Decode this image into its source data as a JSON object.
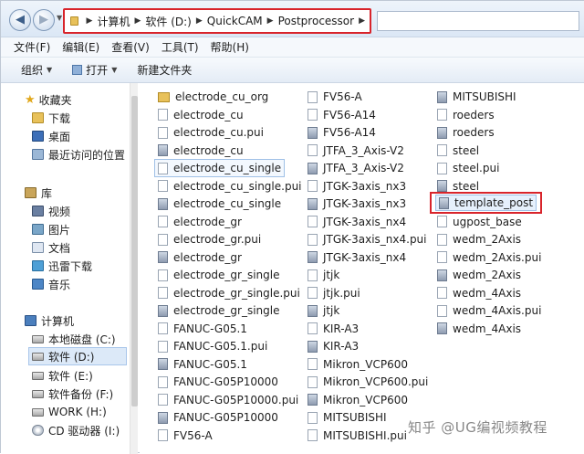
{
  "address": {
    "crumbs": [
      "计算机",
      "软件 (D:)",
      "QuickCAM",
      "Postprocessor"
    ],
    "back_glyph": "◀",
    "forward_glyph": "▶"
  },
  "menu": [
    "文件(F)",
    "编辑(E)",
    "查看(V)",
    "工具(T)",
    "帮助(H)"
  ],
  "toolbar": {
    "organize": "组织",
    "open": "打开",
    "new_folder": "新建文件夹"
  },
  "nav": {
    "favorites": {
      "label": "收藏夹",
      "items": [
        "下载",
        "桌面",
        "最近访问的位置"
      ]
    },
    "libraries": {
      "label": "库",
      "items": [
        "视频",
        "图片",
        "文档",
        "迅雷下载",
        "音乐"
      ]
    },
    "computer": {
      "label": "计算机",
      "items": [
        "本地磁盘 (C:)",
        "软件 (D:)",
        "软件 (E:)",
        "软件备份 (F:)",
        "WORK (H:)",
        "CD 驱动器 (I:)"
      ],
      "selected": "软件 (D:)"
    }
  },
  "files": {
    "col1": [
      {
        "name": "electrode_cu_org",
        "icon": "folder"
      },
      {
        "name": "electrode_cu",
        "icon": "file"
      },
      {
        "name": "electrode_cu.pui",
        "icon": "file"
      },
      {
        "name": "electrode_cu",
        "icon": "filled"
      },
      {
        "name": "electrode_cu_single",
        "icon": "file"
      },
      {
        "name": "electrode_cu_single.pui",
        "icon": "file"
      },
      {
        "name": "electrode_cu_single",
        "icon": "filled"
      },
      {
        "name": "electrode_gr",
        "icon": "file"
      },
      {
        "name": "electrode_gr.pui",
        "icon": "file"
      },
      {
        "name": "electrode_gr",
        "icon": "filled"
      },
      {
        "name": "electrode_gr_single",
        "icon": "file"
      },
      {
        "name": "electrode_gr_single.pui",
        "icon": "file"
      },
      {
        "name": "electrode_gr_single",
        "icon": "filled"
      },
      {
        "name": "FANUC-G05.1",
        "icon": "file"
      },
      {
        "name": "FANUC-G05.1.pui",
        "icon": "file"
      },
      {
        "name": "FANUC-G05.1",
        "icon": "filled"
      },
      {
        "name": "FANUC-G05P10000",
        "icon": "file"
      },
      {
        "name": "FANUC-G05P10000.pui",
        "icon": "file"
      },
      {
        "name": "FANUC-G05P10000",
        "icon": "filled"
      },
      {
        "name": "FV56-A",
        "icon": "file"
      }
    ],
    "col2": [
      {
        "name": "FV56-A",
        "icon": "file"
      },
      {
        "name": "FV56-A14",
        "icon": "file"
      },
      {
        "name": "FV56-A14",
        "icon": "filled"
      },
      {
        "name": "JTFA_3_Axis-V2",
        "icon": "file"
      },
      {
        "name": "JTFA_3_Axis-V2",
        "icon": "filled"
      },
      {
        "name": "JTGK-3axis_nx3",
        "icon": "file"
      },
      {
        "name": "JTGK-3axis_nx3",
        "icon": "filled"
      },
      {
        "name": "JTGK-3axis_nx4",
        "icon": "file"
      },
      {
        "name": "JTGK-3axis_nx4.pui",
        "icon": "file"
      },
      {
        "name": "JTGK-3axis_nx4",
        "icon": "filled"
      },
      {
        "name": "jtjk",
        "icon": "file"
      },
      {
        "name": "jtjk.pui",
        "icon": "file"
      },
      {
        "name": "jtjk",
        "icon": "filled"
      },
      {
        "name": "KIR-A3",
        "icon": "file"
      },
      {
        "name": "KIR-A3",
        "icon": "filled"
      },
      {
        "name": "Mikron_VCP600",
        "icon": "file"
      },
      {
        "name": "Mikron_VCP600.pui",
        "icon": "file"
      },
      {
        "name": "Mikron_VCP600",
        "icon": "filled"
      },
      {
        "name": "MITSUBISHI",
        "icon": "file"
      },
      {
        "name": "MITSUBISHI.pui",
        "icon": "file"
      }
    ],
    "col3": [
      {
        "name": "MITSUBISHI",
        "icon": "filled"
      },
      {
        "name": "roeders",
        "icon": "file"
      },
      {
        "name": "roeders",
        "icon": "filled"
      },
      {
        "name": "steel",
        "icon": "file"
      },
      {
        "name": "steel.pui",
        "icon": "file"
      },
      {
        "name": "steel",
        "icon": "filled"
      },
      {
        "name": "template_post",
        "icon": "filled"
      },
      {
        "name": "ugpost_base",
        "icon": "file"
      },
      {
        "name": "wedm_2Axis",
        "icon": "file"
      },
      {
        "name": "wedm_2Axis.pui",
        "icon": "file"
      },
      {
        "name": "wedm_2Axis",
        "icon": "filled"
      },
      {
        "name": "wedm_4Axis",
        "icon": "file"
      },
      {
        "name": "wedm_4Axis.pui",
        "icon": "file"
      },
      {
        "name": "wedm_4Axis",
        "icon": "filled"
      }
    ]
  },
  "watermark": "知乎 @UG编视频教程"
}
